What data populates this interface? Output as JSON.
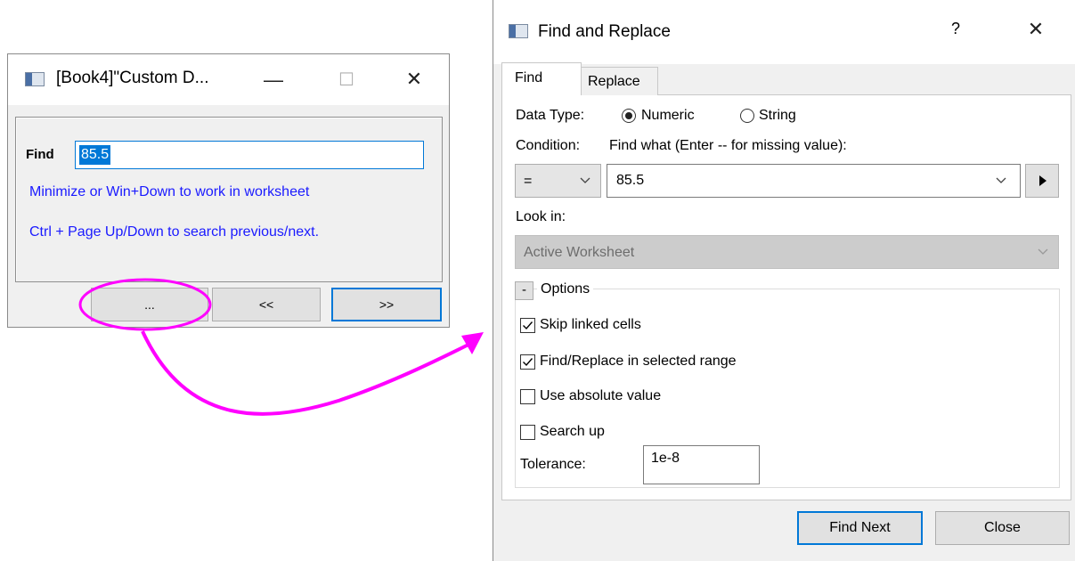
{
  "small_dialog": {
    "title": "[Book4]\"Custom D...",
    "find_label": "Find",
    "find_value": "85.5",
    "hint_minimize": "Minimize or Win+Down to work in worksheet",
    "hint_ctrl": "Ctrl + Page Up/Down to search previous/next.",
    "more_button": "...",
    "prev_button": "<<",
    "next_button": ">>"
  },
  "find_replace": {
    "title": "Find and Replace",
    "help_glyph": "?",
    "tabs": [
      {
        "label": "Find",
        "active": true
      },
      {
        "label": "Replace",
        "active": false
      }
    ],
    "data_type_label": "Data Type:",
    "data_type_options": [
      {
        "label": "Numeric",
        "selected": true
      },
      {
        "label": "String",
        "selected": false
      }
    ],
    "condition_label": "Condition:",
    "find_what_label": "Find what (Enter -- for missing value):",
    "condition_value": "=",
    "find_what_value": "85.5",
    "look_in_label": "Look in:",
    "look_in_value": "Active Worksheet",
    "options_collapse": "-",
    "options_label": "Options",
    "checkboxes": [
      {
        "label": "Skip linked cells",
        "checked": true
      },
      {
        "label": "Find/Replace in selected range",
        "checked": true
      },
      {
        "label": "Use absolute value",
        "checked": false
      },
      {
        "label": "Search up",
        "checked": false
      }
    ],
    "tolerance_label": "Tolerance:",
    "tolerance_value": "1e-8",
    "find_next_button": "Find Next",
    "close_button": "Close"
  },
  "colors": {
    "accent": "#0078d7",
    "hint_text": "#1a1aff",
    "annotation": "#ff00ff"
  },
  "icons": [
    "app-icon",
    "minimize-icon",
    "maximize-icon",
    "close-icon",
    "chevron-down-icon",
    "play-arrow-icon",
    "check-icon"
  ]
}
